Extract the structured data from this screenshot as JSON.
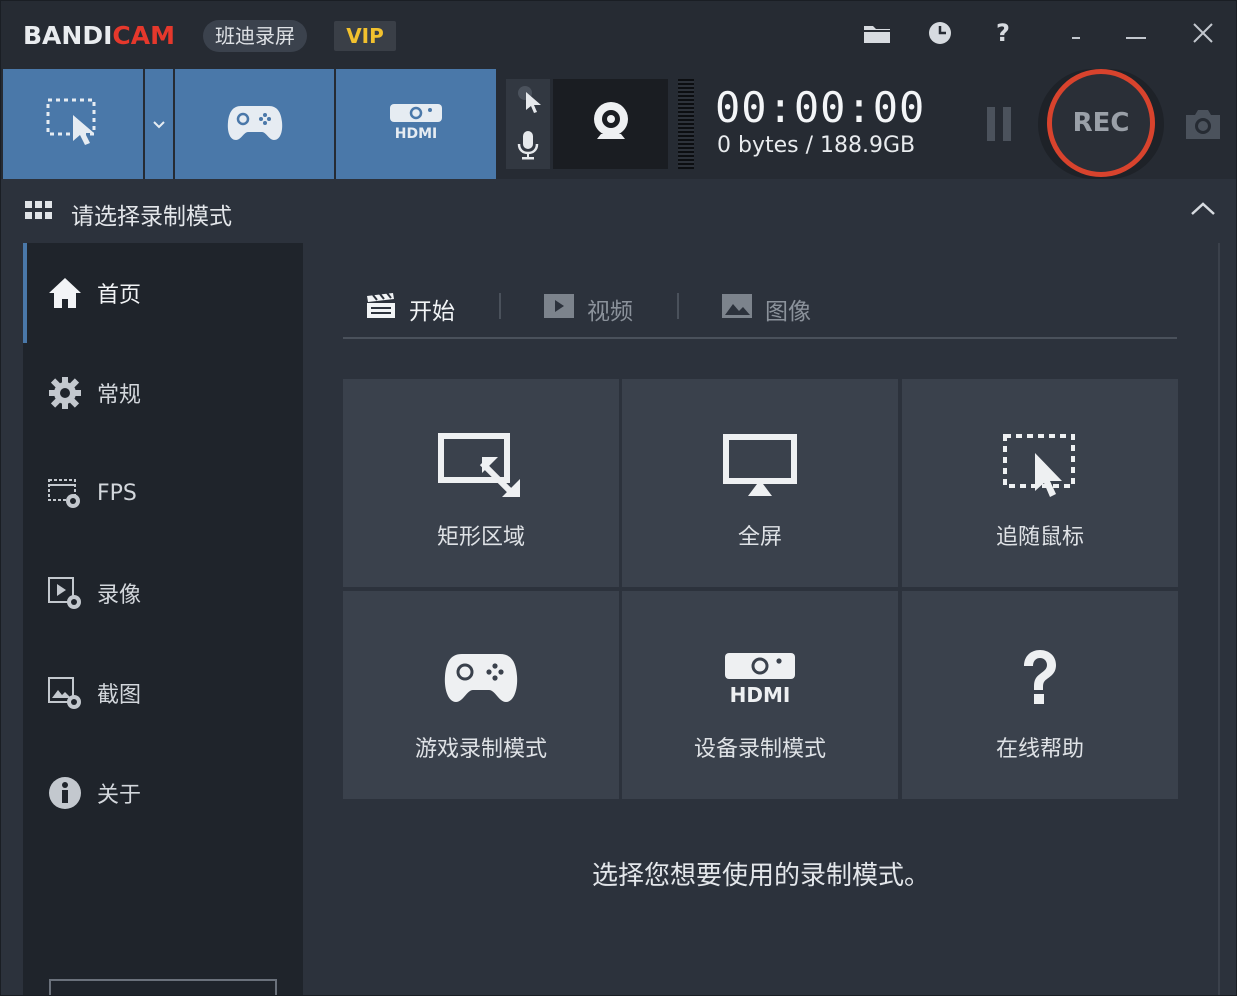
{
  "app": {
    "logo_part1": "BANDI",
    "logo_part2": "CAM",
    "cn_name": "班迪录屏",
    "vip_label": "VIP",
    "help_label": "?",
    "minimize_label": "_",
    "colors": {
      "accent": "#4a78a9",
      "rec_ring": "#d8432d",
      "logo_red": "#e5382c",
      "vip_yellow": "#f2c12e"
    }
  },
  "toolbar": {
    "timer": "00:00:00",
    "bytes": "0 bytes / 188.9GB",
    "rec_label": "REC"
  },
  "header": {
    "title": "请选择录制模式"
  },
  "sidebar": {
    "items": [
      {
        "label": "首页",
        "icon": "home-icon",
        "active": true
      },
      {
        "label": "常规",
        "icon": "gear-icon"
      },
      {
        "label": "FPS",
        "icon": "fps-icon"
      },
      {
        "label": "录像",
        "icon": "video-settings-icon"
      },
      {
        "label": "截图",
        "icon": "image-settings-icon"
      },
      {
        "label": "关于",
        "icon": "info-icon"
      }
    ]
  },
  "tabs": [
    {
      "label": "开始",
      "icon": "clapper-icon",
      "active": true
    },
    {
      "label": "视频",
      "icon": "play-icon"
    },
    {
      "label": "图像",
      "icon": "image-icon"
    }
  ],
  "modes": [
    {
      "label": "矩形区域",
      "icon": "rectangle-area-icon"
    },
    {
      "label": "全屏",
      "icon": "monitor-icon"
    },
    {
      "label": "追随鼠标",
      "icon": "follow-mouse-icon"
    },
    {
      "label": "游戏录制模式",
      "icon": "gamepad-icon"
    },
    {
      "label": "设备录制模式",
      "icon": "hdmi-icon"
    },
    {
      "label": "在线帮助",
      "icon": "help-icon"
    }
  ],
  "hint": "选择您想要使用的录制模式。"
}
